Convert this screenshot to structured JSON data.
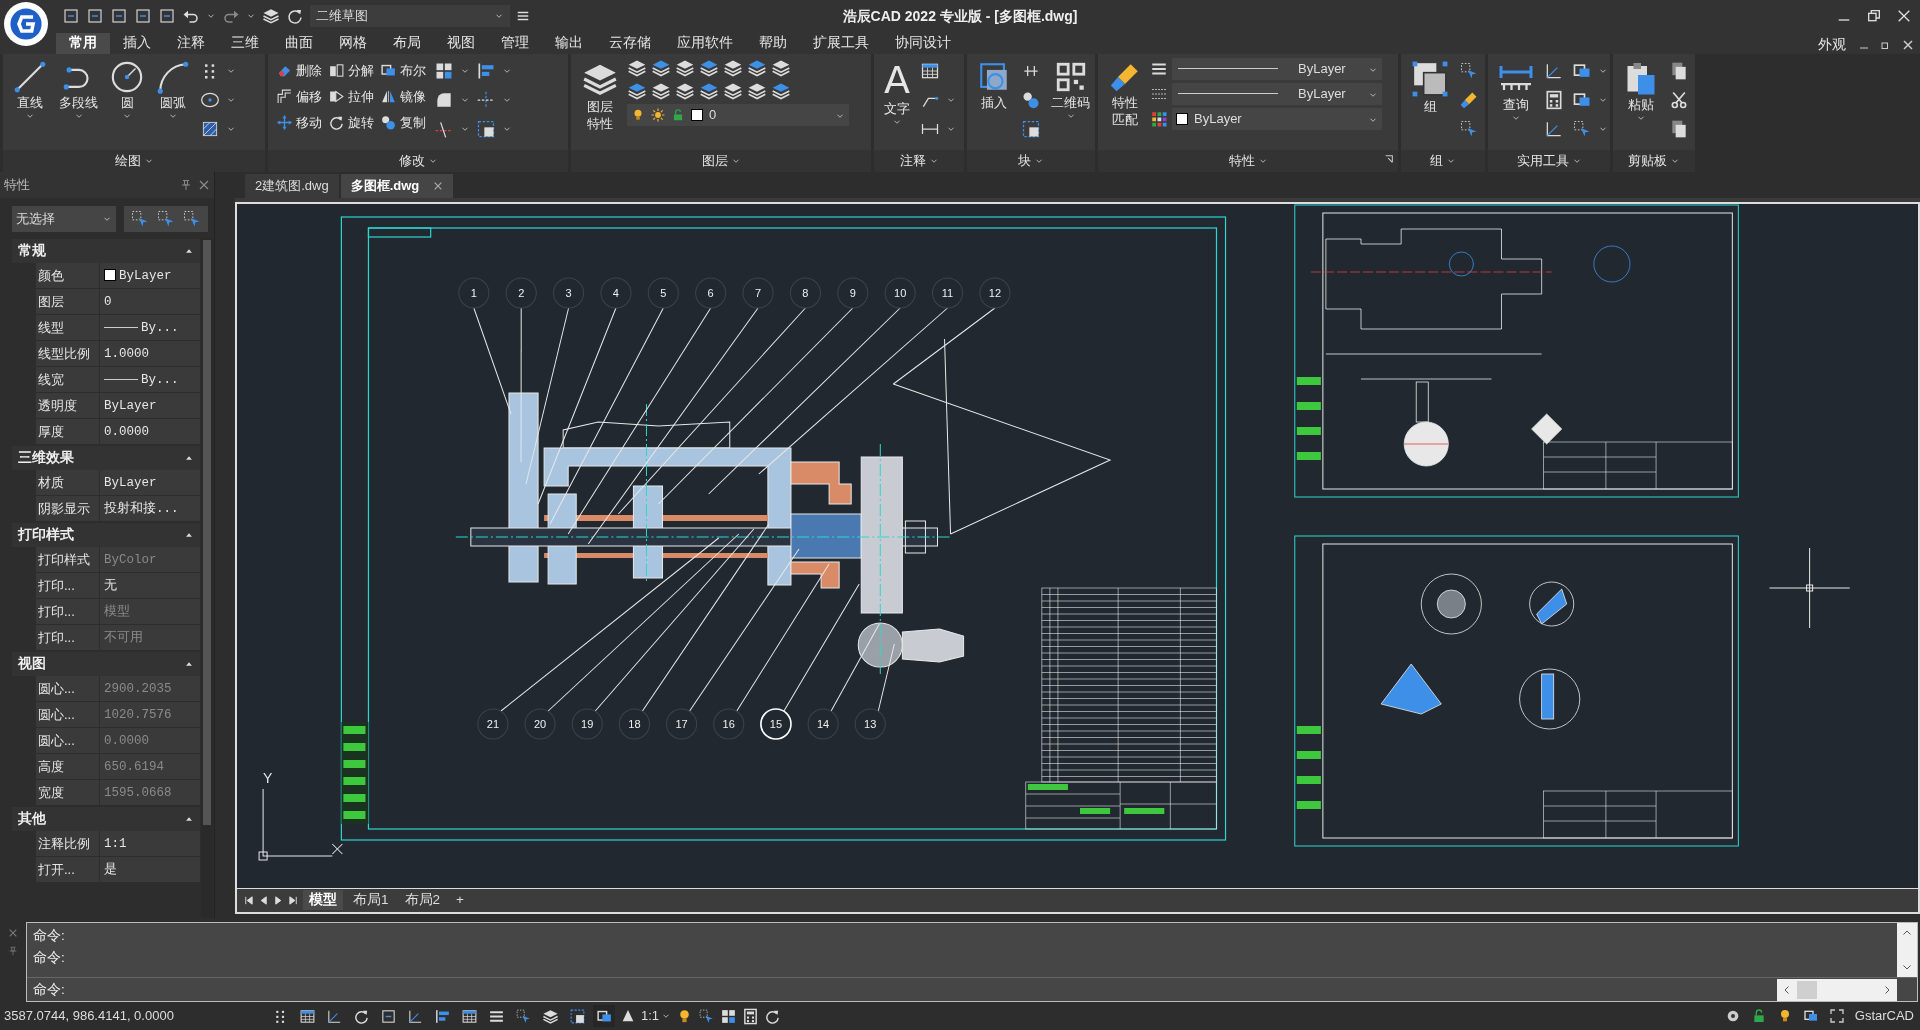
{
  "title_bar": {
    "workspace": "二维草图",
    "title": "浩辰CAD 2022 专业版 - [多图框.dwg]"
  },
  "menu_tabs": [
    {
      "label": "常用",
      "selected": true
    },
    {
      "label": "插入",
      "selected": false
    },
    {
      "label": "注释",
      "selected": false
    },
    {
      "label": "三维",
      "selected": false
    },
    {
      "label": "曲面",
      "selected": false
    },
    {
      "label": "网格",
      "selected": false
    },
    {
      "label": "布局",
      "selected": false
    },
    {
      "label": "视图",
      "selected": false
    },
    {
      "label": "管理",
      "selected": false
    },
    {
      "label": "输出",
      "selected": false
    },
    {
      "label": "云存储",
      "selected": false
    },
    {
      "label": "应用软件",
      "selected": false
    },
    {
      "label": "帮助",
      "selected": false
    },
    {
      "label": "扩展工具",
      "selected": false
    },
    {
      "label": "协同设计",
      "selected": false
    }
  ],
  "appearance_menu": "外观",
  "ribbon_panels": [
    {
      "kind": "draw",
      "title": "绘图",
      "large": [
        "直线",
        "多段线",
        "圆",
        "圆弧"
      ]
    },
    {
      "kind": "modify",
      "title": "修改",
      "small": [
        "删除",
        "分解",
        "布尔",
        "偏移",
        "拉伸",
        "镜像",
        "移动",
        "旋转",
        "复制"
      ]
    },
    {
      "kind": "layer",
      "title": "图层",
      "large": [
        "图层特性"
      ],
      "layer_value": "0"
    },
    {
      "kind": "annotate",
      "title": "注释",
      "large": [
        "文字"
      ],
      "glyph": "A"
    },
    {
      "kind": "block",
      "title": "块",
      "large": [
        "插入",
        "二维码"
      ]
    },
    {
      "kind": "properties",
      "title": "特性",
      "large": [
        "特性匹配"
      ],
      "dropdowns": [
        {
          "kind": "line",
          "value": "ByLayer"
        },
        {
          "kind": "line",
          "value": "ByLayer"
        },
        {
          "kind": "color",
          "value": "ByLayer"
        }
      ]
    },
    {
      "kind": "group",
      "title": "组",
      "large": [
        "组"
      ]
    },
    {
      "kind": "utilities",
      "title": "实用工具",
      "large": [
        "查询"
      ]
    },
    {
      "kind": "clipboard",
      "title": "剪贴板",
      "large": [
        "粘贴"
      ]
    }
  ],
  "properties_panel": {
    "title": "特性",
    "selection": "无选择",
    "sections": [
      {
        "title": "常规",
        "expanded": true,
        "rows": [
          {
            "label": "颜色",
            "value": "ByLayer",
            "kind": "color",
            "disabled": false
          },
          {
            "label": "图层",
            "value": "0",
            "kind": "text",
            "disabled": false
          },
          {
            "label": "线型",
            "value": "By...",
            "kind": "linetype",
            "disabled": false
          },
          {
            "label": "线型比例",
            "value": "1.0000",
            "kind": "text",
            "disabled": false
          },
          {
            "label": "线宽",
            "value": "By...",
            "kind": "linetype",
            "disabled": false
          },
          {
            "label": "透明度",
            "value": "ByLayer",
            "kind": "text",
            "disabled": false
          },
          {
            "label": "厚度",
            "value": "0.0000",
            "kind": "text",
            "disabled": false
          }
        ]
      },
      {
        "title": "三维效果",
        "expanded": true,
        "rows": [
          {
            "label": "材质",
            "value": "ByLayer",
            "kind": "text",
            "disabled": false
          },
          {
            "label": "阴影显示",
            "value": "投射和接...",
            "kind": "text",
            "disabled": false
          }
        ]
      },
      {
        "title": "打印样式",
        "expanded": true,
        "rows": [
          {
            "label": "打印样式",
            "value": "ByColor",
            "kind": "text",
            "disabled": true
          },
          {
            "label": "打印...",
            "value": "无",
            "kind": "text",
            "disabled": false
          },
          {
            "label": "打印...",
            "value": "模型",
            "kind": "text",
            "disabled": true
          },
          {
            "label": "打印...",
            "value": "不可用",
            "kind": "text",
            "disabled": true
          }
        ]
      },
      {
        "title": "视图",
        "expanded": true,
        "rows": [
          {
            "label": "圆心...",
            "value": "2900.2035",
            "kind": "text",
            "disabled": true
          },
          {
            "label": "圆心...",
            "value": "1020.7576",
            "kind": "text",
            "disabled": true
          },
          {
            "label": "圆心...",
            "value": "0.0000",
            "kind": "text",
            "disabled": true
          },
          {
            "label": "高度",
            "value": "650.6194",
            "kind": "text",
            "disabled": true
          },
          {
            "label": "宽度",
            "value": "1595.0668",
            "kind": "text",
            "disabled": true
          }
        ]
      },
      {
        "title": "其他",
        "expanded": true,
        "rows": [
          {
            "label": "注释比例",
            "value": "1:1",
            "kind": "text",
            "disabled": false
          },
          {
            "label": "打开...",
            "value": "是",
            "kind": "text",
            "disabled": false
          }
        ]
      }
    ]
  },
  "document_tabs": [
    {
      "label": "2建筑图.dwg",
      "selected": false
    },
    {
      "label": "多图框.dwg",
      "selected": true
    }
  ],
  "drawing": {
    "ucs_label": "Y",
    "balloons_top": [
      {
        "number": "1",
        "highlighted": false
      },
      {
        "number": "2",
        "highlighted": false
      },
      {
        "number": "3",
        "highlighted": false
      },
      {
        "number": "4",
        "highlighted": false
      },
      {
        "number": "5",
        "highlighted": false
      },
      {
        "number": "6",
        "highlighted": false
      },
      {
        "number": "7",
        "highlighted": false
      },
      {
        "number": "8",
        "highlighted": false
      },
      {
        "number": "9",
        "highlighted": false
      },
      {
        "number": "10",
        "highlighted": false
      },
      {
        "number": "11",
        "highlighted": false
      },
      {
        "number": "12",
        "highlighted": false
      }
    ],
    "balloons_bottom": [
      {
        "number": "21",
        "highlighted": false
      },
      {
        "number": "20",
        "highlighted": false
      },
      {
        "number": "19",
        "highlighted": false
      },
      {
        "number": "18",
        "highlighted": false
      },
      {
        "number": "17",
        "highlighted": false
      },
      {
        "number": "16",
        "highlighted": false
      },
      {
        "number": "15",
        "highlighted": true
      },
      {
        "number": "14",
        "highlighted": false
      },
      {
        "number": "13",
        "highlighted": false
      }
    ]
  },
  "layout_tabs": [
    {
      "label": "模型",
      "selected": true
    },
    {
      "label": "布局1",
      "selected": false
    },
    {
      "label": "布局2",
      "selected": false
    },
    {
      "label": "+",
      "selected": false
    }
  ],
  "command_history": [
    "命令:",
    "命令:"
  ],
  "command_prompt": "命令:",
  "status_bar": {
    "coordinates": "3587.0744, 986.4141, 0.0000",
    "annotation_scale": "1:1",
    "brand": "GstarCAD"
  }
}
